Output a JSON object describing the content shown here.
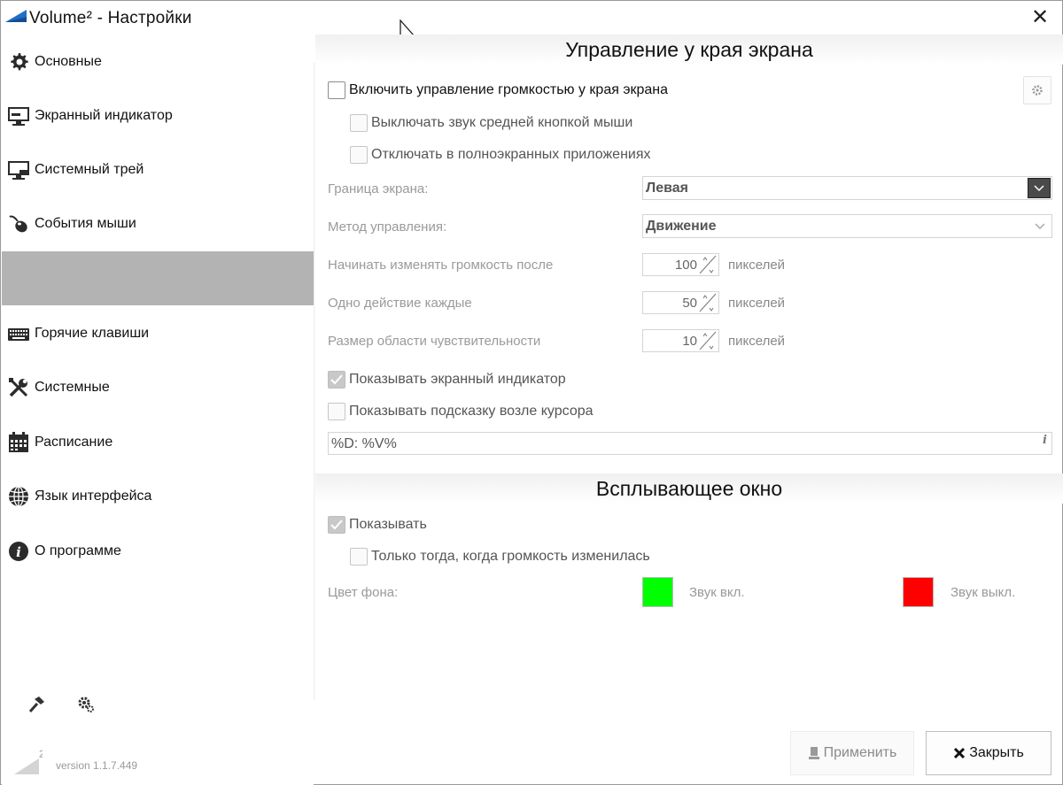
{
  "window": {
    "title": "Volume² - Настройки",
    "close_glyph": "✕"
  },
  "sidebar": {
    "items": [
      {
        "label": "Основные",
        "icon": "gear-icon"
      },
      {
        "label": "Экранный индикатор",
        "icon": "monitor-icon"
      },
      {
        "label": "Системный трей",
        "icon": "tray-icon"
      },
      {
        "label": "События мыши",
        "icon": "mouse-icon"
      },
      {
        "label": "",
        "icon": "",
        "active": true
      },
      {
        "label": "Горячие клавиши",
        "icon": "keyboard-icon"
      },
      {
        "label": "Системные",
        "icon": "tools-icon"
      },
      {
        "label": "Расписание",
        "icon": "calendar-icon"
      },
      {
        "label": "Язык интерфейса",
        "icon": "globe-icon"
      },
      {
        "label": "О программе",
        "icon": "info-icon"
      }
    ],
    "footer_icons": [
      "hammer-icon",
      "gears-icon"
    ],
    "version": "version 1.1.7.449",
    "version_badge": "2"
  },
  "screen_edge": {
    "title": "Управление у края экрана",
    "enable": {
      "label": "Включить управление громкостью у края экрана",
      "checked": false
    },
    "mute_middle": {
      "label": "Выключать звук средней кнопкой мыши",
      "checked": false
    },
    "disable_fullscreen": {
      "label": "Отключать в полноэкранных приложениях",
      "checked": false
    },
    "border": {
      "label": "Граница экрана:",
      "value": "Левая"
    },
    "method": {
      "label": "Метод управления:",
      "value": "Движение"
    },
    "start_after": {
      "label": "Начинать изменять громкость после",
      "value": "100",
      "unit": "пикселей"
    },
    "action_every": {
      "label": "Одно действие каждые",
      "value": "50",
      "unit": "пикселей"
    },
    "area_size": {
      "label": "Размер области чувствительности",
      "value": "10",
      "unit": "пикселей"
    },
    "show_osd": {
      "label": "Показывать экранный индикатор",
      "checked": true
    },
    "show_tooltip": {
      "label": "Показывать подсказку возле курсора",
      "checked": false
    },
    "tooltip_format": "%D: %V%",
    "info_glyph": "i"
  },
  "popup": {
    "title": "Всплывающее окно",
    "show": {
      "label": "Показывать",
      "checked": true
    },
    "only_changed": {
      "label": "Только тогда, когда громкость изменилась",
      "checked": false
    },
    "bg_label": "Цвет фона:",
    "sound_on": {
      "label": "Звук вкл.",
      "color": "#00ff00"
    },
    "sound_off": {
      "label": "Звук выкл.",
      "color": "#ff0000"
    }
  },
  "buttons": {
    "apply": "Применить",
    "close": "Закрыть"
  }
}
